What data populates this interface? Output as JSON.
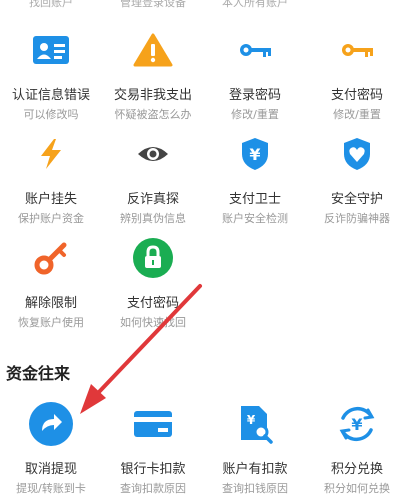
{
  "top_partial": [
    "找回账户",
    "管理登录设备",
    "本人所有账户"
  ],
  "section_title": "资金往来",
  "grid": [
    [
      {
        "title": "认证信息错误",
        "sub": "可以修改吗",
        "icon": "id-card-icon",
        "color": "#1e90e6"
      },
      {
        "title": "交易非我支出",
        "sub": "怀疑被盗怎么办",
        "icon": "warning-triangle-icon",
        "color": "#f6a21b"
      },
      {
        "title": "登录密码",
        "sub": "修改/重置",
        "icon": "blue-key-icon",
        "color": "#1e90e6"
      },
      {
        "title": "支付密码",
        "sub": "修改/重置",
        "icon": "orange-key-icon",
        "color": "#f6a21b"
      }
    ],
    [
      {
        "title": "账户挂失",
        "sub": "保护账户资金",
        "icon": "lightning-icon",
        "color": "#f6a21b"
      },
      {
        "title": "反诈真探",
        "sub": "辨别真伪信息",
        "icon": "eye-icon",
        "color": "#444444"
      },
      {
        "title": "支付卫士",
        "sub": "账户安全检测",
        "icon": "shield-yen-icon",
        "color": "#1e90e6"
      },
      {
        "title": "安全守护",
        "sub": "反诈防骗神器",
        "icon": "shield-heart-icon",
        "color": "#1e90e6"
      }
    ],
    [
      {
        "title": "解除限制",
        "sub": "恢复账户使用",
        "icon": "key-unlock-icon",
        "color": "#f0642a"
      },
      {
        "title": "支付密码",
        "sub": "如何快速找回",
        "icon": "lock-icon",
        "color": "#1aad52"
      }
    ],
    [
      {
        "title": "取消提现",
        "sub": "提现/转账到卡",
        "icon": "share-arrow-icon",
        "color": "#1e90e6"
      },
      {
        "title": "银行卡扣款",
        "sub": "查询扣款原因",
        "icon": "bank-card-icon",
        "color": "#1e90e6"
      },
      {
        "title": "账户有扣款",
        "sub": "查询扣钱原因",
        "icon": "document-search-icon",
        "color": "#1e90e6"
      },
      {
        "title": "积分兑换",
        "sub": "积分如何兑换",
        "icon": "yen-exchange-icon",
        "color": "#1e90e6"
      }
    ]
  ],
  "annotation": {
    "color": "#e0383a",
    "icon": "red-arrow-annotation"
  }
}
